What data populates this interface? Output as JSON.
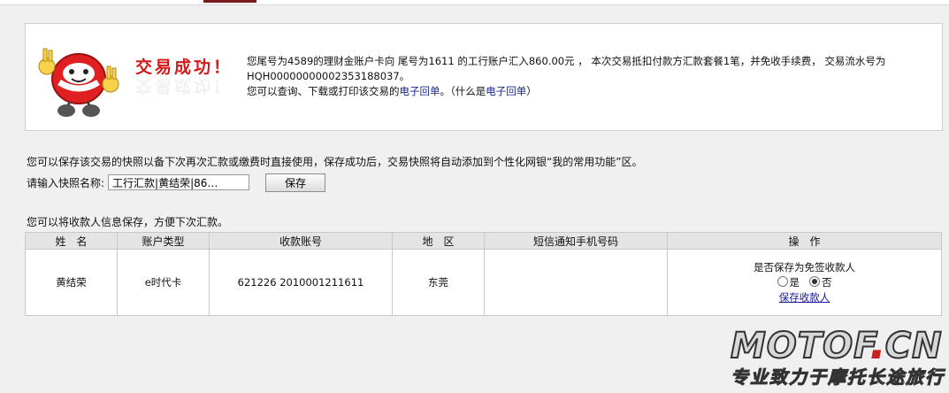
{
  "success": {
    "title": "交易成功！",
    "line1": "您尾号为4589的理财金账户卡向 尾号为1611 的工行账户汇入860.00元 ， 本次交易抵扣付款方汇款套餐1笔，并免收手续费， 交易流水号为",
    "line2": "HQH00000000002353188037。",
    "line3_prefix": "您可以查询、下载或打印该交易的",
    "link_receipt": "电子回单",
    "line3_mid": "。（什么是",
    "link_what": "电子回单",
    "line3_suffix": "）"
  },
  "snapshot": {
    "description": "您可以保存该交易的快照以备下次再次汇款或缴费时直接使用，保存成功后，交易快照将自动添加到个性化网银“我的常用功能”区。",
    "label": "请输入快照名称:",
    "input_value": "工行汇款|黄结荣|86…",
    "save_label": "保存"
  },
  "payee": {
    "description": "您可以将收款人信息保存，方便下次汇款。",
    "headers": [
      "姓　名",
      "账户类型",
      "收款账号",
      "地　区",
      "短信通知手机号码",
      "操　作"
    ],
    "row": {
      "name": "黄结荣",
      "account_type": "e时代卡",
      "account_no": "621226 2010001211611",
      "region": "东莞",
      "phone": "",
      "save_question": "是否保存为免签收款人",
      "yes": "是",
      "no": "否",
      "no_selected": true,
      "save_payee_link": "保存收款人"
    }
  },
  "watermark": {
    "main_left": "MOTOF",
    "main_dot": ".",
    "main_right": "CN",
    "sub": "专业致力于摩托长途旅行"
  }
}
